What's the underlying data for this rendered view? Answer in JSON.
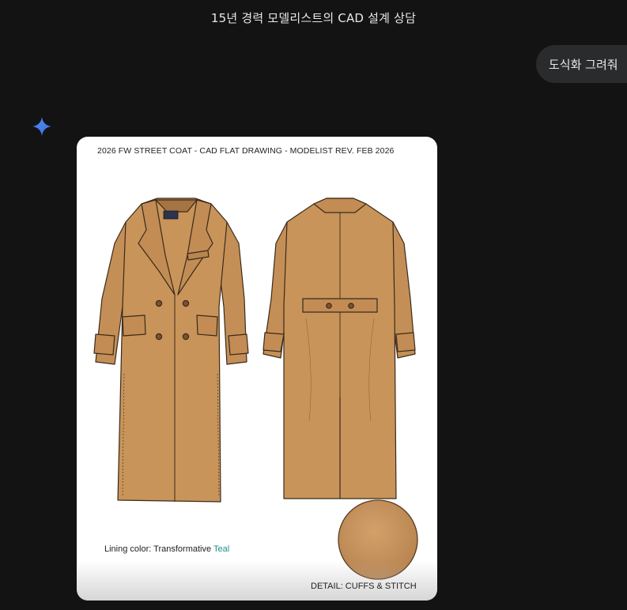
{
  "conversation": {
    "title": "15년 경력 모델리스트의 CAD 설계 상담"
  },
  "user_message": {
    "text": "도식화 그려줘"
  },
  "assistant": {
    "icon": "gemini-sparkle-icon",
    "image": {
      "header": "2026 FW STREET COAT - CAD FLAT DRAWING - MODELIST REV. FEB 2026",
      "lining_label": "Lining color: Transformative ",
      "lining_color_name": "Teal",
      "detail_label": "DETAIL: CUFFS & STITCH"
    }
  },
  "colors": {
    "background": "#131313",
    "bubble": "#2a2b2c",
    "coat": "#c8945a",
    "lining": "#1f8c8c"
  }
}
